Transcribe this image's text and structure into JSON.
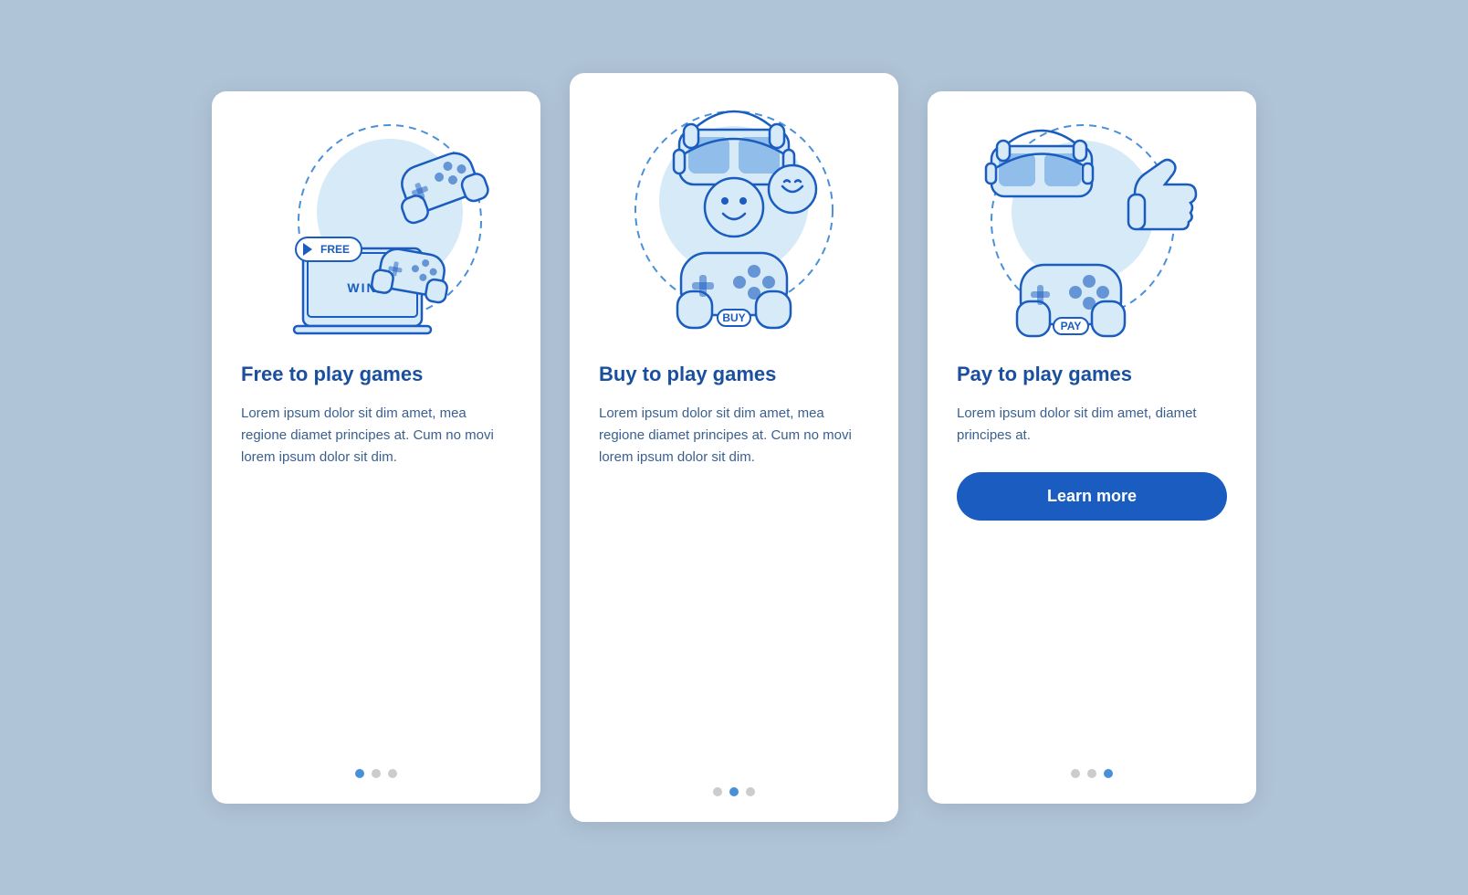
{
  "cards": [
    {
      "id": "free-to-play",
      "title": "Free to play games",
      "body": "Lorem ipsum dolor sit dim amet, mea regione diamet principes at. Cum no movi lorem ipsum dolor sit dim.",
      "dots": [
        true,
        false,
        false
      ],
      "has_button": false,
      "button_label": null,
      "badge": "FREE",
      "badge2": "WIN"
    },
    {
      "id": "buy-to-play",
      "title": "Buy to play games",
      "body": "Lorem ipsum dolor sit dim amet, mea regione diamet principes at. Cum no movi lorem ipsum dolor sit dim.",
      "dots": [
        false,
        true,
        false
      ],
      "has_button": false,
      "button_label": null,
      "badge": "BUY"
    },
    {
      "id": "pay-to-play",
      "title": "Pay to play games",
      "body": "Lorem ipsum dolor sit dim amet, diamet principes at.",
      "dots": [
        false,
        false,
        true
      ],
      "has_button": true,
      "button_label": "Learn more",
      "badge": "PAY"
    }
  ]
}
